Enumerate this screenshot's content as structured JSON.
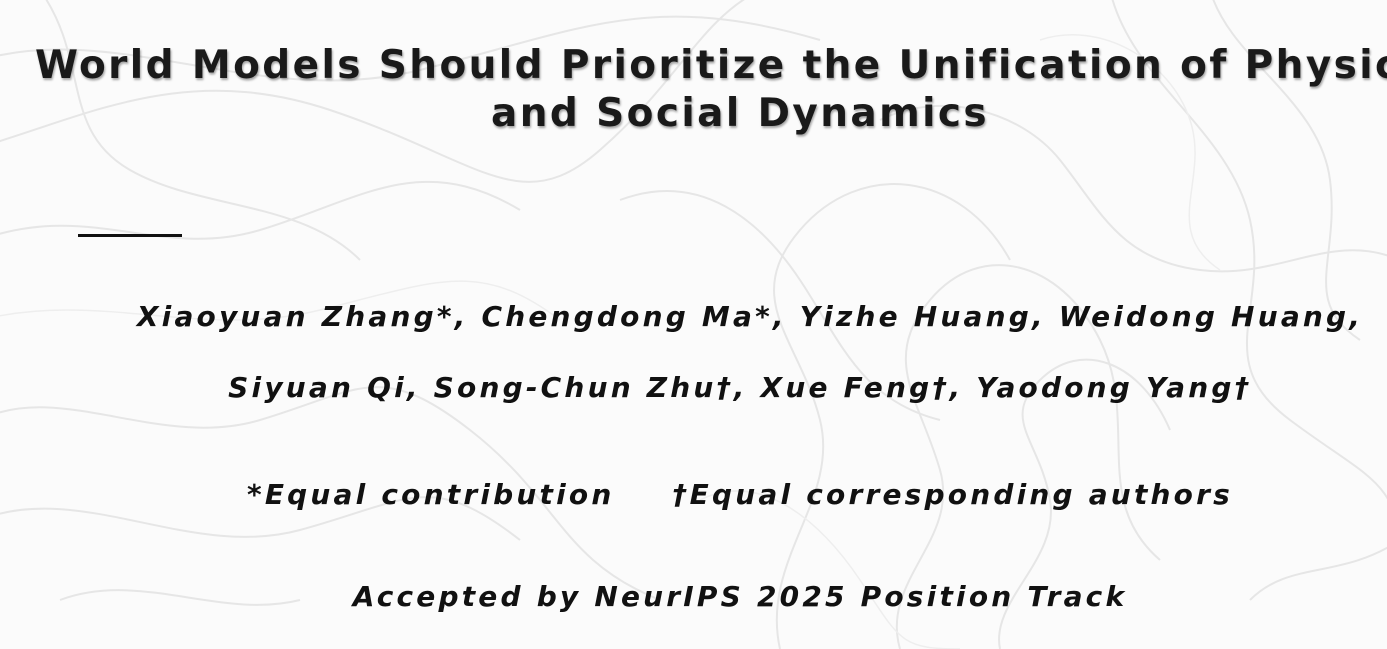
{
  "title": {
    "line1": "World Models Should Prioritize the Unification of Physical",
    "line2": "and Social Dynamics"
  },
  "authors": {
    "line1": "Xiaoyuan Zhang*, Chengdong Ma*, Yizhe Huang, Weidong Huang,",
    "line2": "Siyuan Qi, Song-Chun Zhu†, Xue Feng†, Yaodong Yang†"
  },
  "notes": {
    "equal_contribution": "*Equal contribution",
    "equal_corresponding": "†Equal corresponding authors"
  },
  "venue": "Accepted by NeurIPS 2025 Position Track"
}
